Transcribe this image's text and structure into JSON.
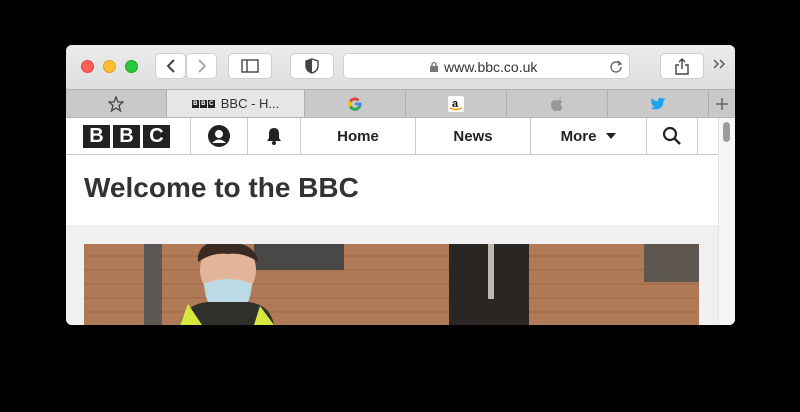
{
  "browser": {
    "address_bar": {
      "url": "www.bbc.co.uk"
    },
    "tabs": [
      {
        "type": "favorites",
        "icon": "star-icon"
      },
      {
        "type": "page",
        "icon": "bbc-favicon",
        "label": "BBC - H..."
      },
      {
        "type": "page",
        "icon": "google-favicon"
      },
      {
        "type": "page",
        "icon": "amazon-favicon"
      },
      {
        "type": "page",
        "icon": "apple-favicon"
      },
      {
        "type": "page",
        "icon": "twitter-favicon"
      }
    ]
  },
  "site": {
    "logo_letters": [
      "B",
      "B",
      "C"
    ],
    "nav": {
      "home": "Home",
      "news": "News",
      "more": "More"
    },
    "welcome_heading": "Welcome to the BBC"
  },
  "colors": {
    "twitter": "#1da1f2",
    "bbc_black": "#222222",
    "traffic_red": "#fe5f57",
    "traffic_yellow": "#febc2e",
    "traffic_green": "#28c840"
  }
}
